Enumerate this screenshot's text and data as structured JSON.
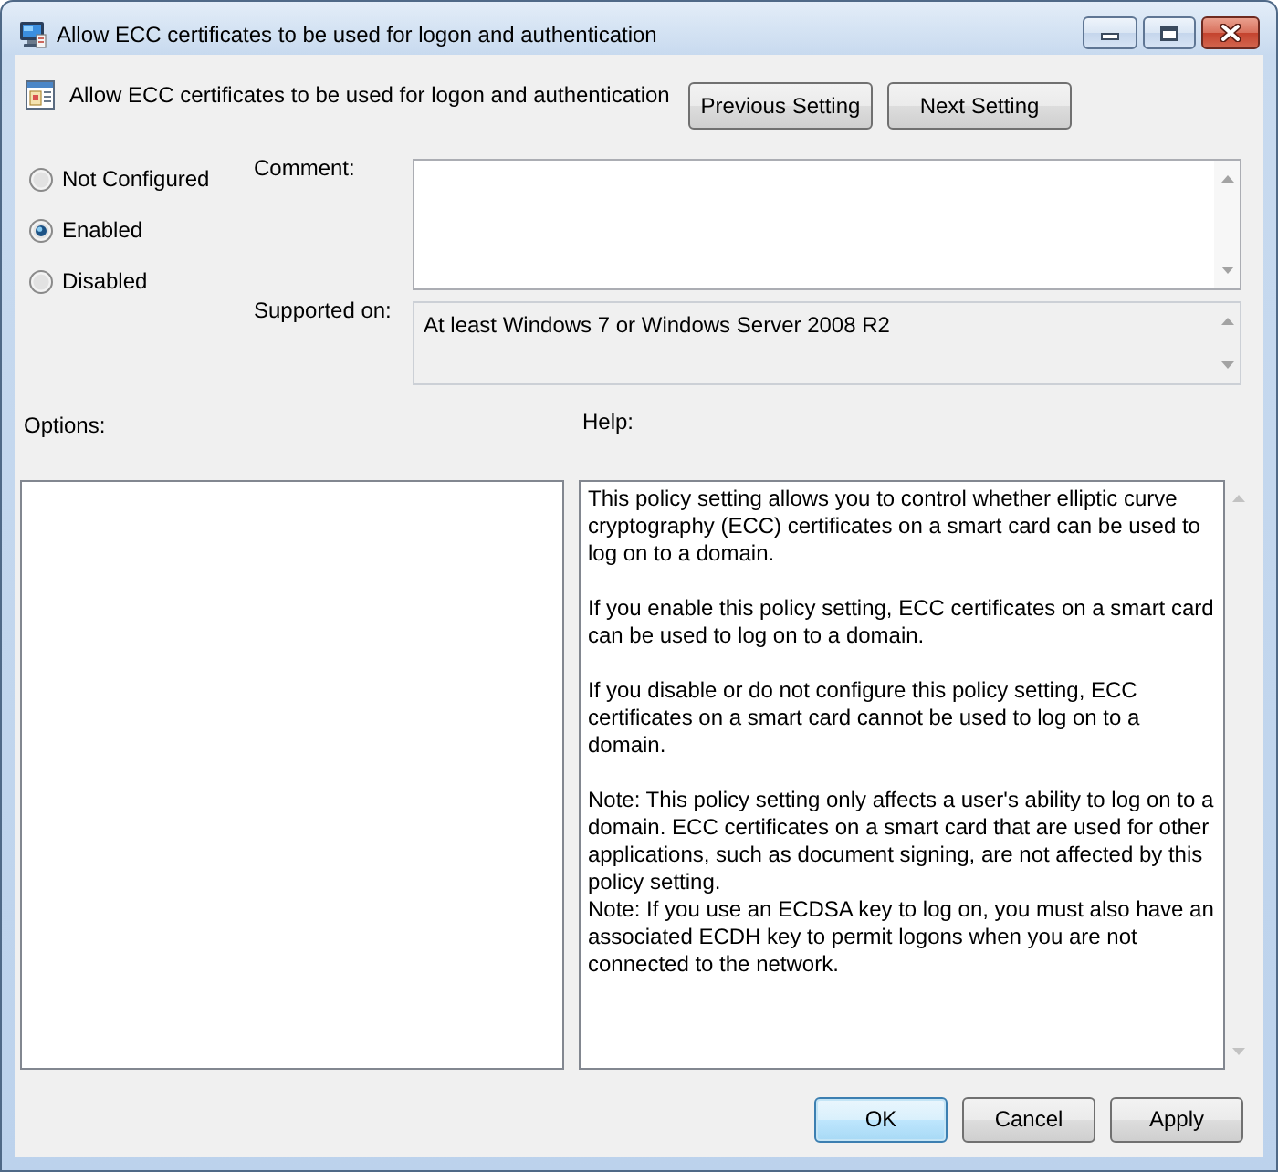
{
  "window": {
    "title": "Allow ECC certificates to be used for logon and authentication"
  },
  "header": {
    "title": "Allow ECC certificates to be used for logon and authentication",
    "buttons": [
      {
        "label": "Previous Setting"
      },
      {
        "label": "Next Setting"
      }
    ]
  },
  "state_options": [
    {
      "label": "Not Configured",
      "selected": false
    },
    {
      "label": "Enabled",
      "selected": true
    },
    {
      "label": "Disabled",
      "selected": false
    }
  ],
  "comment": {
    "label": "Comment:"
  },
  "supported_on": {
    "label": "Supported on:",
    "value": "At least Windows 7 or Windows Server 2008 R2"
  },
  "options": {
    "label": "Options:"
  },
  "help": {
    "label": "Help:",
    "paragraphs": [
      "This policy setting allows you to control whether elliptic curve cryptography (ECC) certificates on a smart card can be used to log on to a domain.",
      "If you enable this policy setting, ECC certificates on a smart card can be used to log on to a domain.",
      "If you disable or do not configure this policy setting, ECC certificates on a smart card cannot be used to log on to a domain.",
      "Note: This policy setting only affects a user's ability to log on to a domain. ECC certificates on a smart card that are used for other applications, such as document signing, are not affected by this policy setting.\nNote: If you use an ECDSA key to log on, you must also have an associated ECDH key to permit logons when you are not connected to the network."
    ]
  },
  "buttons": [
    {
      "label": "OK",
      "default": true
    },
    {
      "label": "Cancel",
      "default": false
    },
    {
      "label": "Apply",
      "default": false
    }
  ]
}
